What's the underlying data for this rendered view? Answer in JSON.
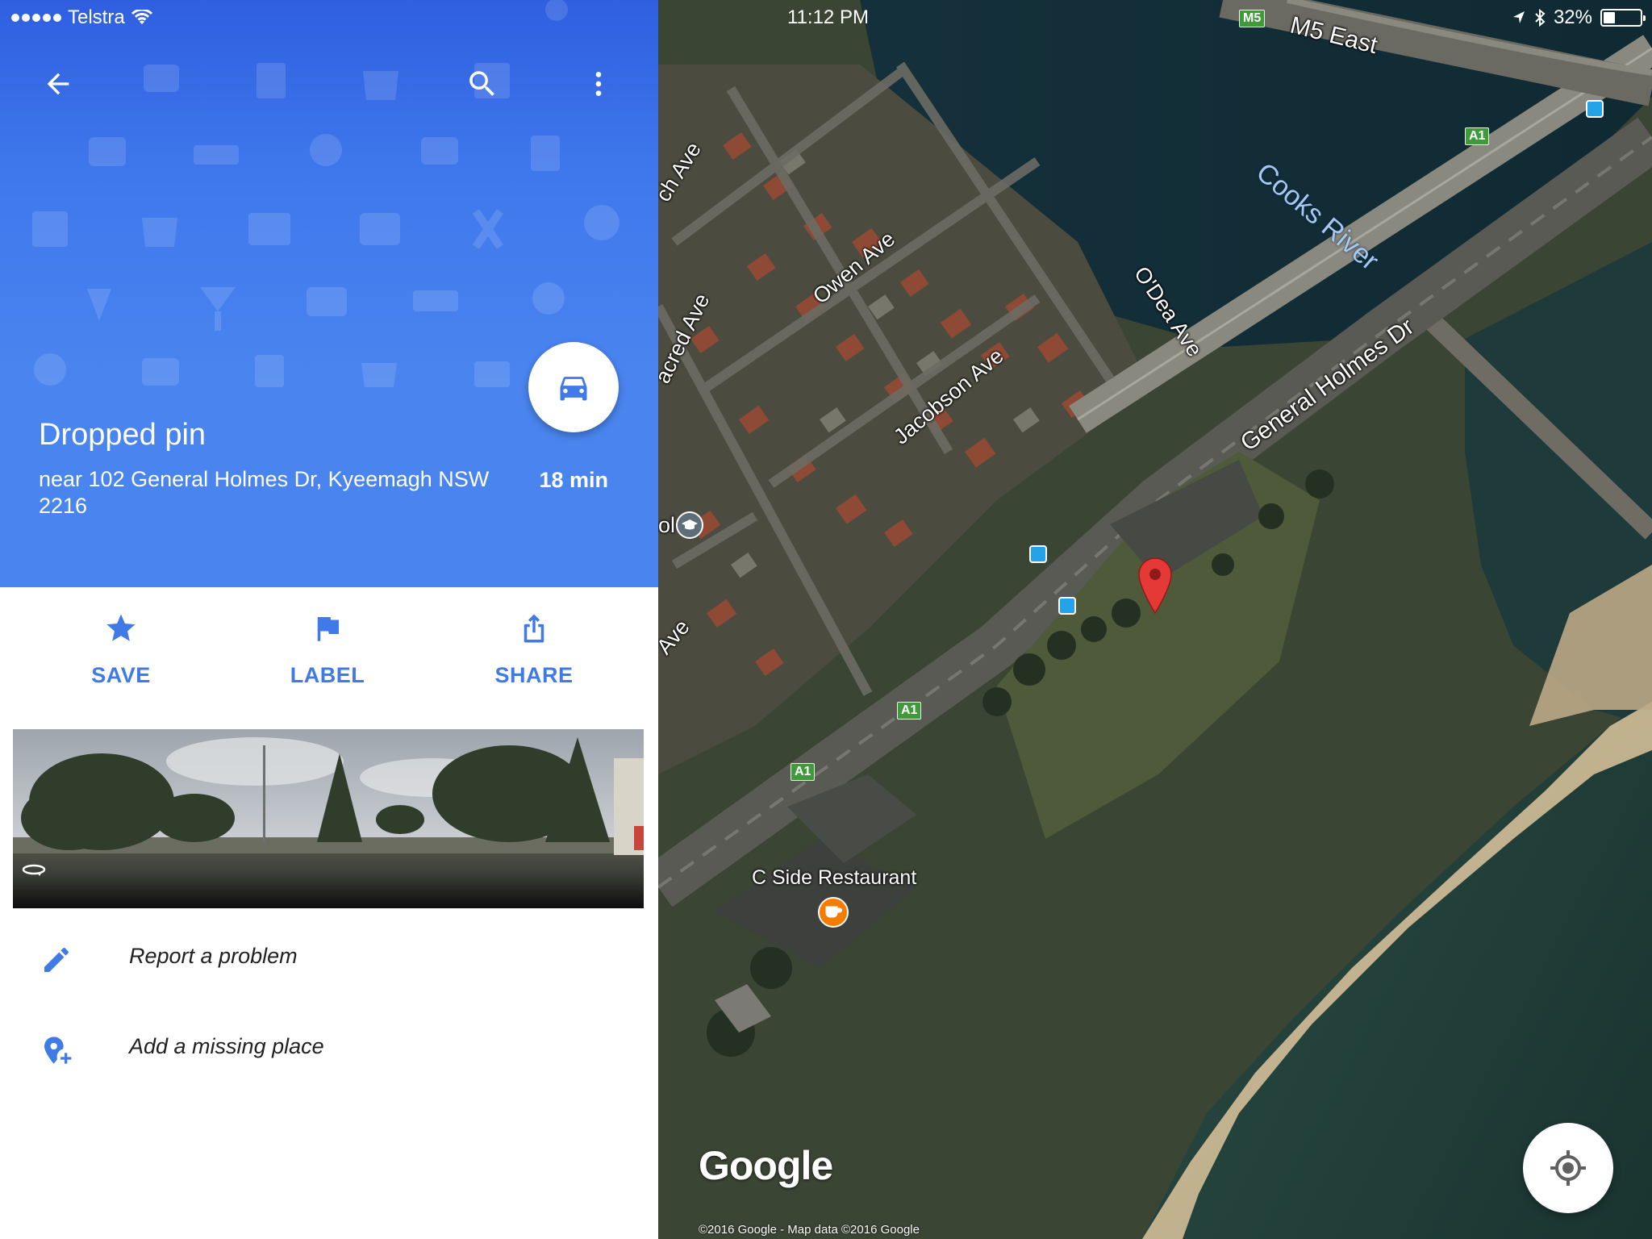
{
  "status_bar": {
    "carrier": "Telstra",
    "time": "11:12 PM",
    "battery": "32%",
    "battery_level": 0.32
  },
  "toolbar": {
    "back_icon": "arrow-back-icon",
    "search_icon": "search-icon",
    "more_icon": "more-vert-icon"
  },
  "place": {
    "title": "Dropped pin",
    "address": "near 102 General Holmes Dr, Kyeemagh NSW 2216",
    "eta": "18 min",
    "directions_icon": "car-icon"
  },
  "actions": [
    {
      "label": "SAVE",
      "icon": "star-icon"
    },
    {
      "label": "LABEL",
      "icon": "flag-icon"
    },
    {
      "label": "SHARE",
      "icon": "share-icon"
    }
  ],
  "list_items": [
    {
      "label": "Report a problem",
      "icon": "pencil-icon"
    },
    {
      "label": "Add a missing place",
      "icon": "add-place-icon"
    }
  ],
  "map": {
    "labels": {
      "m5_east": "M5 East",
      "cooks_river": "Cooks River",
      "general_holmes": "General Holmes Dr",
      "owen_ave": "Owen Ave",
      "odea_ave": "O'Dea Ave",
      "jacobson_ave": "Jacobson Ave",
      "sacred_ave": "acred Ave",
      "arch_ave": "ch Ave",
      "ave_partial": "Ave",
      "school_partial": "ol",
      "restaurant": "C Side Restaurant"
    },
    "shields": {
      "m5": "M5",
      "a1": "A1"
    },
    "logo": "Google",
    "copyright": "©2016 Google - Map data ©2016 Google"
  },
  "colors": {
    "primary_blue": "#4a85ef",
    "accent_blue": "#3f7ae6",
    "pin_red": "#e53935"
  }
}
